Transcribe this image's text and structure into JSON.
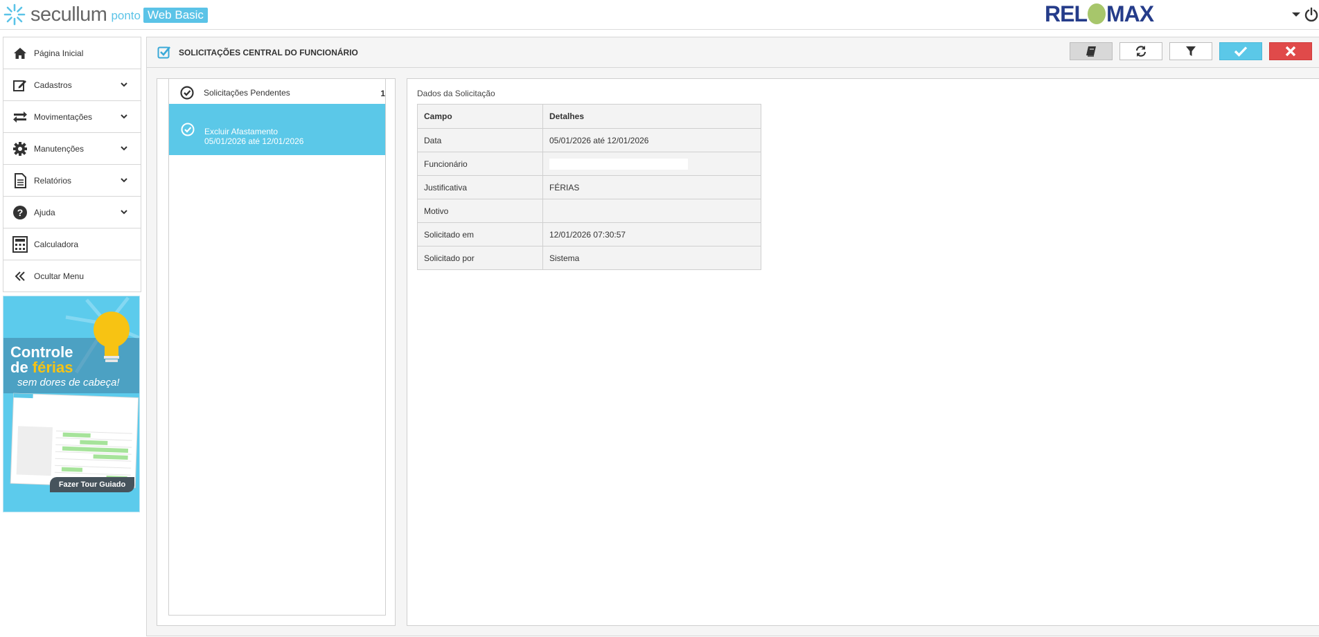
{
  "header": {
    "logo_brand": "secullum",
    "logo_product": "ponto",
    "logo_edition": "Web Basic",
    "company_logo": "RELÓMAX",
    "user_menu_icon": "chevron-down-icon",
    "power_icon": "power-icon"
  },
  "sidebar": {
    "items": [
      {
        "label": "Página Inicial",
        "icon": "home-icon"
      },
      {
        "label": "Cadastros",
        "icon": "edit-icon"
      },
      {
        "label": "Movimentações",
        "icon": "exchange-icon"
      },
      {
        "label": "Manutenções",
        "icon": "gear-icon"
      },
      {
        "label": "Relatórios",
        "icon": "document-icon"
      },
      {
        "label": "Ajuda",
        "icon": "help-icon"
      },
      {
        "label": "Calculadora",
        "icon": "calculator-icon"
      },
      {
        "label": "Ocultar Menu",
        "icon": "double-chevron-left-icon"
      }
    ]
  },
  "banner": {
    "line1": "Controle",
    "line2_a": "de ",
    "line2_b": "férias",
    "line3": "sem dores de cabeça!",
    "cta": "Fazer Tour Guiado"
  },
  "page": {
    "title": "SOLICITAÇÕES CENTRAL DO FUNCIONÁRIO"
  },
  "toolbar": {
    "buttons": [
      {
        "name": "book-button",
        "icon": "book-icon"
      },
      {
        "name": "refresh-button",
        "icon": "refresh-icon"
      },
      {
        "name": "filter-button",
        "icon": "filter-icon"
      },
      {
        "name": "approve-button",
        "icon": "check-icon",
        "color": "#5bc8e8"
      },
      {
        "name": "reject-button",
        "icon": "close-icon",
        "color": "#e04a4a"
      }
    ]
  },
  "requests": {
    "header_label": "Solicitações Pendentes",
    "count": "1",
    "items": [
      {
        "line1": "Excluir Afastamento",
        "line2": "05/01/2026 até 12/01/2026"
      }
    ]
  },
  "details": {
    "title": "Dados da Solicitação",
    "columns": [
      "Campo",
      "Detalhes"
    ],
    "rows": [
      {
        "field": "Data",
        "value": "05/01/2026 até 12/01/2026"
      },
      {
        "field": "Funcionário",
        "value": ""
      },
      {
        "field": "Justificativa",
        "value": "FÉRIAS"
      },
      {
        "field": "Motivo",
        "value": ""
      },
      {
        "field": "Solicitado em",
        "value": "12/01/2026 07:30:57"
      },
      {
        "field": "Solicitado por",
        "value": "Sistema"
      }
    ]
  },
  "colors": {
    "accent": "#5bc8e8",
    "danger": "#e04a4a",
    "company": "#253c8a"
  }
}
